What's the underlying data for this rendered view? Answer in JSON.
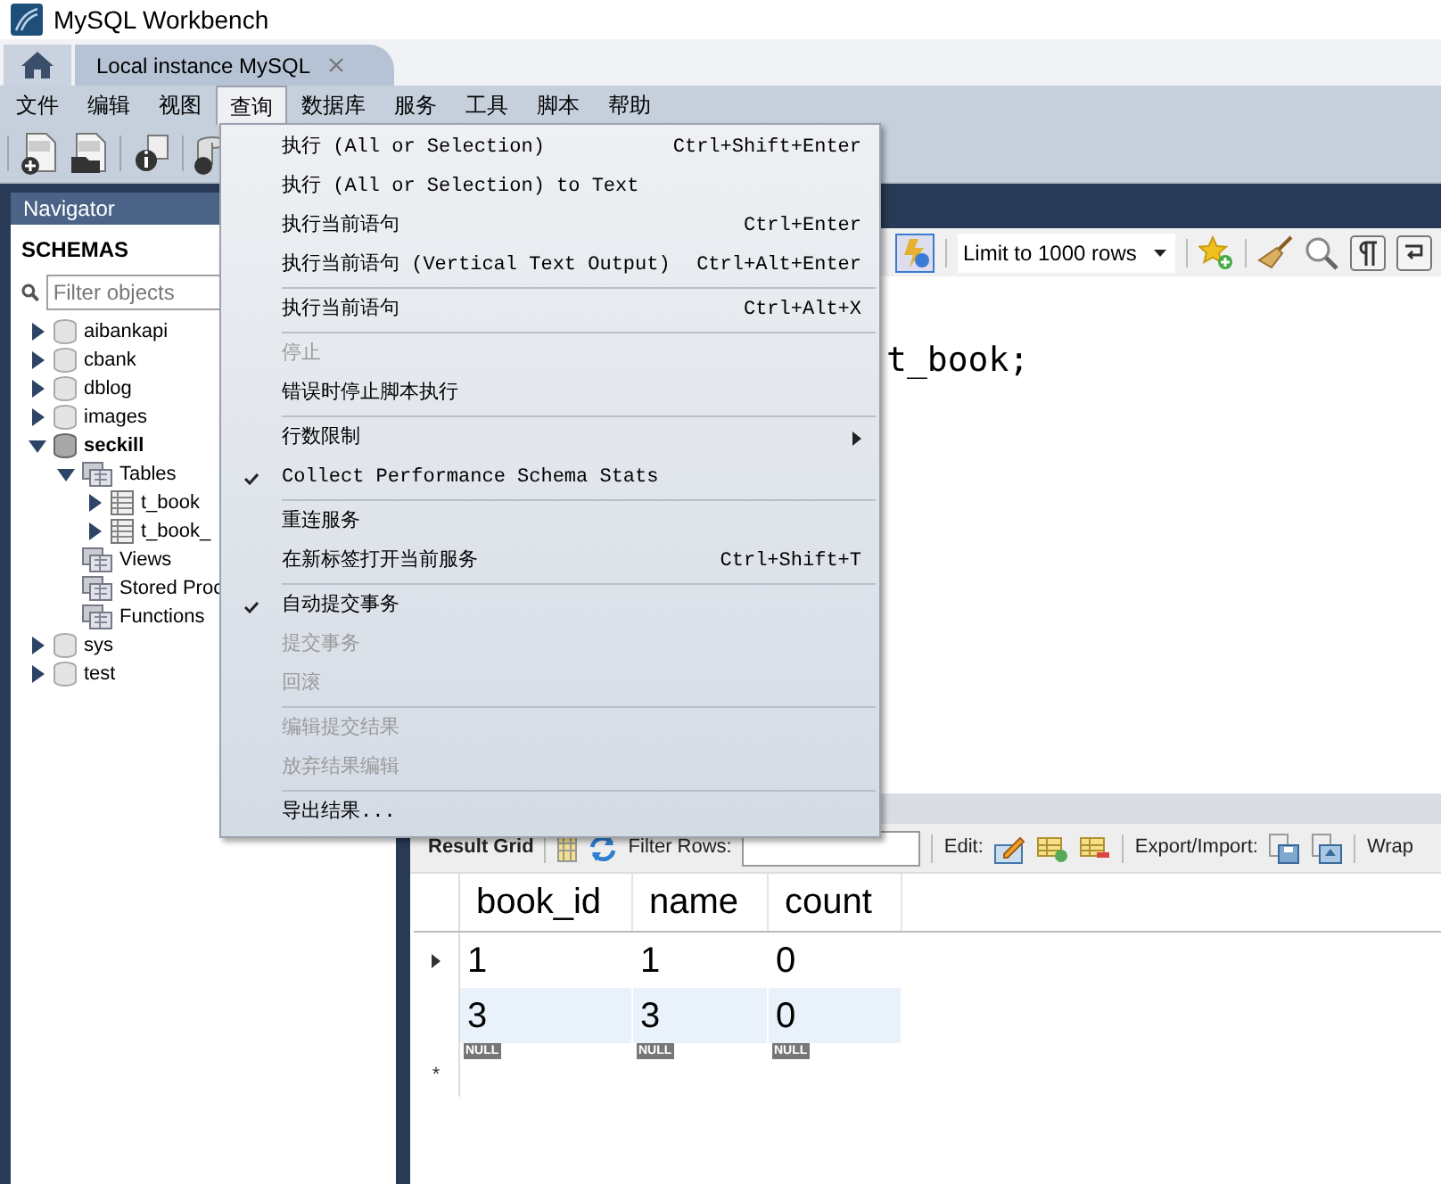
{
  "window": {
    "title": "MySQL Workbench"
  },
  "tabs": [
    {
      "kind": "home",
      "selected": false
    },
    {
      "kind": "connection",
      "label": "Local instance MySQL",
      "selected": true
    }
  ],
  "menu_bar": [
    {
      "label": "文件",
      "selected": false
    },
    {
      "label": "编辑",
      "selected": false
    },
    {
      "label": "视图",
      "selected": false
    },
    {
      "label": "查询",
      "selected": true
    },
    {
      "label": "数据库",
      "selected": false
    },
    {
      "label": "服务",
      "selected": false
    },
    {
      "label": "工具",
      "selected": false
    },
    {
      "label": "脚本",
      "selected": false
    },
    {
      "label": "帮助",
      "selected": false
    }
  ],
  "navigator": {
    "title": "Navigator",
    "section": "SCHEMAS",
    "filter_placeholder": "Filter objects",
    "schemas": [
      {
        "kind": "schema",
        "label": "aibankapi",
        "expanded": false,
        "default": false
      },
      {
        "kind": "schema",
        "label": "cbank",
        "expanded": false,
        "default": false
      },
      {
        "kind": "schema",
        "label": "dblog",
        "expanded": false,
        "default": false
      },
      {
        "kind": "schema",
        "label": "images",
        "expanded": false,
        "default": false
      },
      {
        "kind": "schema",
        "label": "seckill",
        "expanded": true,
        "default": true,
        "children": [
          {
            "kind": "folder",
            "label": "Tables",
            "expanded": true,
            "children": [
              {
                "kind": "table",
                "label": "t_book",
                "expanded": false
              },
              {
                "kind": "table",
                "label": "t_book_",
                "expanded": false
              }
            ]
          },
          {
            "kind": "folder",
            "label": "Views"
          },
          {
            "kind": "folder",
            "label": "Stored Proc"
          },
          {
            "kind": "folder",
            "label": "Functions"
          }
        ]
      },
      {
        "kind": "schema",
        "label": "sys",
        "expanded": false,
        "default": false
      },
      {
        "kind": "schema",
        "label": "test",
        "expanded": false,
        "default": false
      }
    ]
  },
  "editor": {
    "limit": "Limit to 1000 rows",
    "code": "t_book;"
  },
  "result": {
    "tab": "Result Grid",
    "filter_label": "Filter Rows:",
    "edit_label": "Edit:",
    "export_label": "Export/Import:",
    "wrap_label": "Wrap",
    "columns": [
      "book_id",
      "name",
      "count"
    ],
    "rows": [
      {
        "current": true,
        "cells": [
          "1",
          "1",
          "0"
        ]
      },
      {
        "current": false,
        "cells": [
          "3",
          "3",
          "0"
        ]
      }
    ],
    "new_row": {
      "marker": "*",
      "cells": [
        "NULL",
        "NULL",
        "NULL"
      ]
    }
  },
  "query_menu": [
    {
      "kind": "item",
      "label": "执行 (All or Selection)",
      "shortcut": "Ctrl+Shift+Enter",
      "disabled": false,
      "checked": false
    },
    {
      "kind": "item",
      "label": "执行 (All or Selection) to Text",
      "disabled": false,
      "checked": false
    },
    {
      "kind": "item",
      "label": "执行当前语句",
      "shortcut": "Ctrl+Enter",
      "disabled": false,
      "checked": false
    },
    {
      "kind": "item",
      "label": "执行当前语句 (Vertical Text Output)",
      "shortcut": "Ctrl+Alt+Enter",
      "disabled": false,
      "checked": false
    },
    {
      "kind": "separator"
    },
    {
      "kind": "item",
      "label": "执行当前语句",
      "shortcut": "Ctrl+Alt+X",
      "disabled": false,
      "checked": false
    },
    {
      "kind": "separator"
    },
    {
      "kind": "item",
      "label": "停止",
      "disabled": true,
      "checked": false
    },
    {
      "kind": "item",
      "label": "错误时停止脚本执行",
      "disabled": false,
      "checked": false
    },
    {
      "kind": "separator"
    },
    {
      "kind": "submenu",
      "label": "行数限制",
      "disabled": false,
      "checked": false
    },
    {
      "kind": "item",
      "label": "Collect Performance Schema Stats",
      "disabled": false,
      "checked": true
    },
    {
      "kind": "separator"
    },
    {
      "kind": "item",
      "label": "重连服务",
      "disabled": false,
      "checked": false
    },
    {
      "kind": "item",
      "label": "在新标签打开当前服务",
      "shortcut": "Ctrl+Shift+T",
      "disabled": false,
      "checked": false
    },
    {
      "kind": "separator"
    },
    {
      "kind": "item",
      "label": "自动提交事务",
      "disabled": false,
      "checked": true
    },
    {
      "kind": "item",
      "label": "提交事务",
      "disabled": true,
      "checked": false
    },
    {
      "kind": "item",
      "label": "回滚",
      "disabled": true,
      "checked": false
    },
    {
      "kind": "separator"
    },
    {
      "kind": "item",
      "label": "编辑提交结果",
      "disabled": true,
      "checked": false
    },
    {
      "kind": "item",
      "label": "放弃结果编辑",
      "disabled": true,
      "checked": false
    },
    {
      "kind": "separator"
    },
    {
      "kind": "item",
      "label": "导出结果...",
      "disabled": false,
      "checked": false
    }
  ]
}
